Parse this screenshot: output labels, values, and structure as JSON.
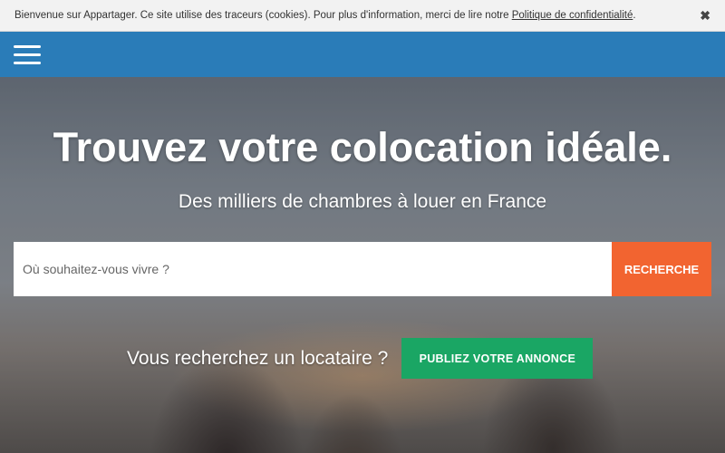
{
  "cookie_banner": {
    "text": "Bienvenue sur Appartager. Ce site utilise des traceurs (cookies). Pour plus d'information, merci de lire notre ",
    "link_label": "Politique de confidentialité",
    "text_end": ".",
    "close_glyph": "✖"
  },
  "navbar": {
    "menu_icon": "hamburger-menu-icon",
    "color": "#2a7cb8"
  },
  "hero": {
    "title": "Trouvez votre colocation idéale.",
    "subtitle": "Des milliers de chambres à louer en France",
    "search": {
      "placeholder": "Où souhaitez-vous vivre ?",
      "value": "",
      "button_label": "RECHERCHE",
      "button_color": "#f26430"
    },
    "landlord_prompt": "Vous recherchez un locataire ?",
    "publish_label": "PUBLIEZ VOTRE ANNONCE",
    "publish_color": "#1aa664"
  }
}
